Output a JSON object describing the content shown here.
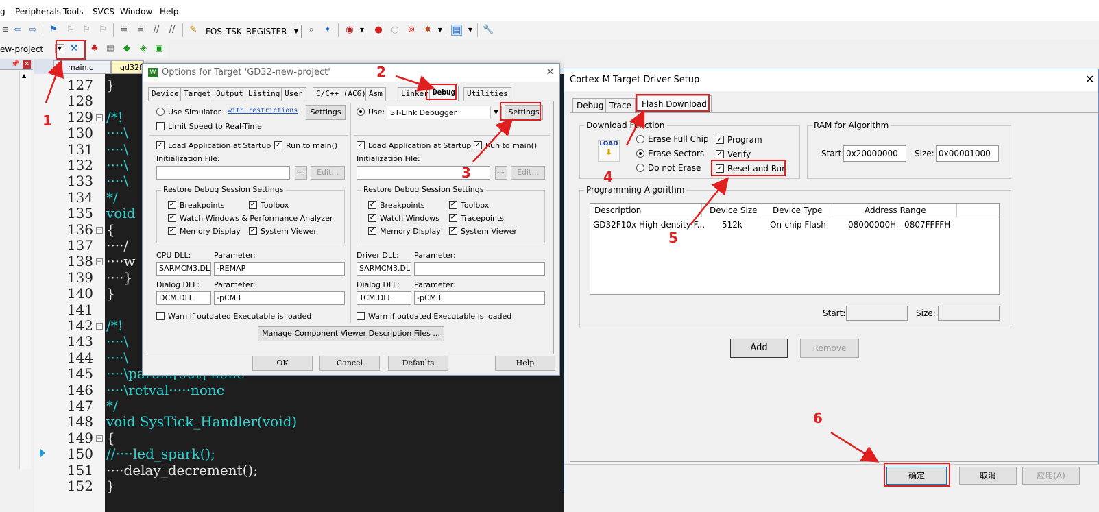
{
  "menu": [
    "g",
    "Peripherals",
    "Tools",
    "SVCS",
    "Window",
    "Help"
  ],
  "toolbar": {
    "target_combo": "FOS_TSK_REGISTER",
    "project_combo": "ew-project"
  },
  "editor_tabs": [
    "main.c",
    "gd32f"
  ],
  "editor": {
    "lines": [
      {
        "n": "127",
        "t": "}"
      },
      {
        "n": "128",
        "t": ""
      },
      {
        "n": "129",
        "t": "/*!"
      },
      {
        "n": "130",
        "t": "····\\"
      },
      {
        "n": "131",
        "t": "····\\"
      },
      {
        "n": "132",
        "t": "····\\"
      },
      {
        "n": "133",
        "t": "····\\"
      },
      {
        "n": "134",
        "t": "*/"
      },
      {
        "n": "135",
        "t": "void"
      },
      {
        "n": "136",
        "t": "{"
      },
      {
        "n": "137",
        "t": "····/"
      },
      {
        "n": "138",
        "t": "····w"
      },
      {
        "n": "139",
        "t": "····}"
      },
      {
        "n": "140",
        "t": "}"
      },
      {
        "n": "141",
        "t": ""
      },
      {
        "n": "142",
        "t": "/*!"
      },
      {
        "n": "143",
        "t": "····\\"
      },
      {
        "n": "144",
        "t": "····\\"
      },
      {
        "n": "145",
        "t": "····\\param[out]·none"
      },
      {
        "n": "146",
        "t": "····\\retval·····none"
      },
      {
        "n": "147",
        "t": "*/"
      },
      {
        "n": "148",
        "t": "void SysTick_Handler(void)"
      },
      {
        "n": "149",
        "t": "{"
      },
      {
        "n": "150",
        "t": "//····led_spark();"
      },
      {
        "n": "151",
        "t": "····delay_decrement();"
      },
      {
        "n": "152",
        "t": "}"
      }
    ]
  },
  "dlg1": {
    "title": "Options for Target 'GD32-new-project'",
    "tabs": [
      "Device",
      "Target",
      "Output",
      "Listing",
      "User",
      "C/C++ (AC6)",
      "Asm",
      "Linker",
      "Debug",
      "Utilities"
    ],
    "left": {
      "use_simulator": "Use Simulator",
      "restrictions": "with restrictions",
      "settings": "Settings",
      "limit_speed": "Limit Speed to Real-Time",
      "load_app": "Load Application at Startup",
      "run_main": "Run to main()",
      "init_file": "Initialization File:",
      "browse": "...",
      "edit": "Edit...",
      "restore": "Restore Debug Session Settings",
      "breakpoints": "Breakpoints",
      "toolbox": "Toolbox",
      "watch": "Watch Windows & Performance Analyzer",
      "memory": "Memory Display",
      "sysviewer": "System Viewer",
      "cpu_dll": "CPU DLL:",
      "param": "Parameter:",
      "cpu_dll_val": "SARMCM3.DLL",
      "cpu_param_val": "-REMAP",
      "dialog_dll": "Dialog DLL:",
      "dialog_dll_val": "DCM.DLL",
      "dialog_param_val": "-pCM3",
      "warn": "Warn if outdated Executable is loaded"
    },
    "right": {
      "use": "Use:",
      "debugger": "ST-Link Debugger",
      "settings": "Settings",
      "load_app": "Load Application at Startup",
      "run_main": "Run to main()",
      "init_file": "Initialization File:",
      "browse": "...",
      "edit": "Edit...",
      "restore": "Restore Debug Session Settings",
      "breakpoints": "Breakpoints",
      "toolbox": "Toolbox",
      "watch": "Watch Windows",
      "tracepoints": "Tracepoints",
      "memory": "Memory Display",
      "sysviewer": "System Viewer",
      "driver_dll": "Driver DLL:",
      "param": "Parameter:",
      "driver_dll_val": "SARMCM3.DLL",
      "driver_param_val": "",
      "dialog_dll": "Dialog DLL:",
      "dialog_dll_val": "TCM.DLL",
      "dialog_param_val": "-pCM3",
      "warn": "Warn if outdated Executable is loaded"
    },
    "manage": "Manage Component Viewer Description Files ...",
    "ok": "OK",
    "cancel": "Cancel",
    "defaults": "Defaults",
    "help": "Help"
  },
  "dlg2": {
    "title": "Cortex-M Target Driver Setup",
    "tabs": [
      "Debug",
      "Trace",
      "Flash Download"
    ],
    "download_function": "Download Function",
    "load_icon": "LOAD",
    "erase_full": "Erase Full Chip",
    "erase_sectors": "Erase Sectors",
    "no_erase": "Do not Erase",
    "program": "Program",
    "verify": "Verify",
    "reset_run": "Reset and Run",
    "ram": "RAM for Algorithm",
    "start": "Start:",
    "start_val": "0x20000000",
    "size": "Size:",
    "size_val": "0x00001000",
    "prog_algo": "Programming Algorithm",
    "cols": [
      "Description",
      "Device Size",
      "Device Type",
      "Address Range"
    ],
    "row": [
      "GD32F10x High-density F...",
      "512k",
      "On-chip Flash",
      "08000000H - 0807FFFFH"
    ],
    "start2": "Start:",
    "size2": "Size:",
    "add": "Add",
    "remove": "Remove",
    "ok": "确定",
    "cancel": "取消",
    "apply": "应用(A)"
  },
  "annotations": [
    "1",
    "2",
    "3",
    "4",
    "5",
    "6"
  ],
  "colors": {
    "red": "#e02020",
    "code_bg": "#1e1e1e",
    "keyword": "#2fd0d0"
  }
}
